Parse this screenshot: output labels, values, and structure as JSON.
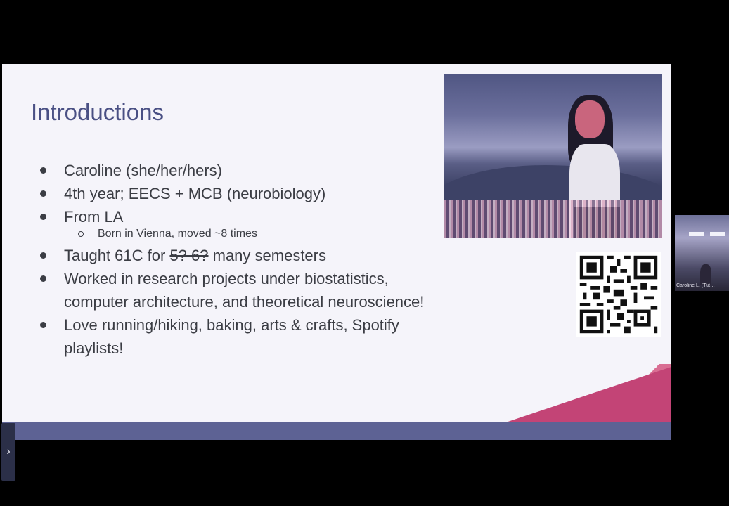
{
  "slide": {
    "title": "Introductions",
    "bullets": {
      "b1": "Caroline (she/her/hers)",
      "b2": "4th year; EECS + MCB (neurobiology)",
      "b3": "From LA",
      "b3_sub": "Born in Vienna, moved ~8 times",
      "b4_pre": "Taught 61C for ",
      "b4_strike": "5? 6?",
      "b4_post": " many semesters",
      "b5": "Worked in research projects under biostatistics, computer architecture, and theoretical neuroscience!",
      "b6": "Love running/hiking, baking, arts & crafts, Spotify playlists!"
    },
    "accent_colors": {
      "title": "#4a5084",
      "triangle": "#c34476",
      "bar": "#5d6294"
    }
  },
  "camera": {
    "label": "Caroline L. (Tut…"
  },
  "sidebar_toggle": {
    "label": "›"
  }
}
